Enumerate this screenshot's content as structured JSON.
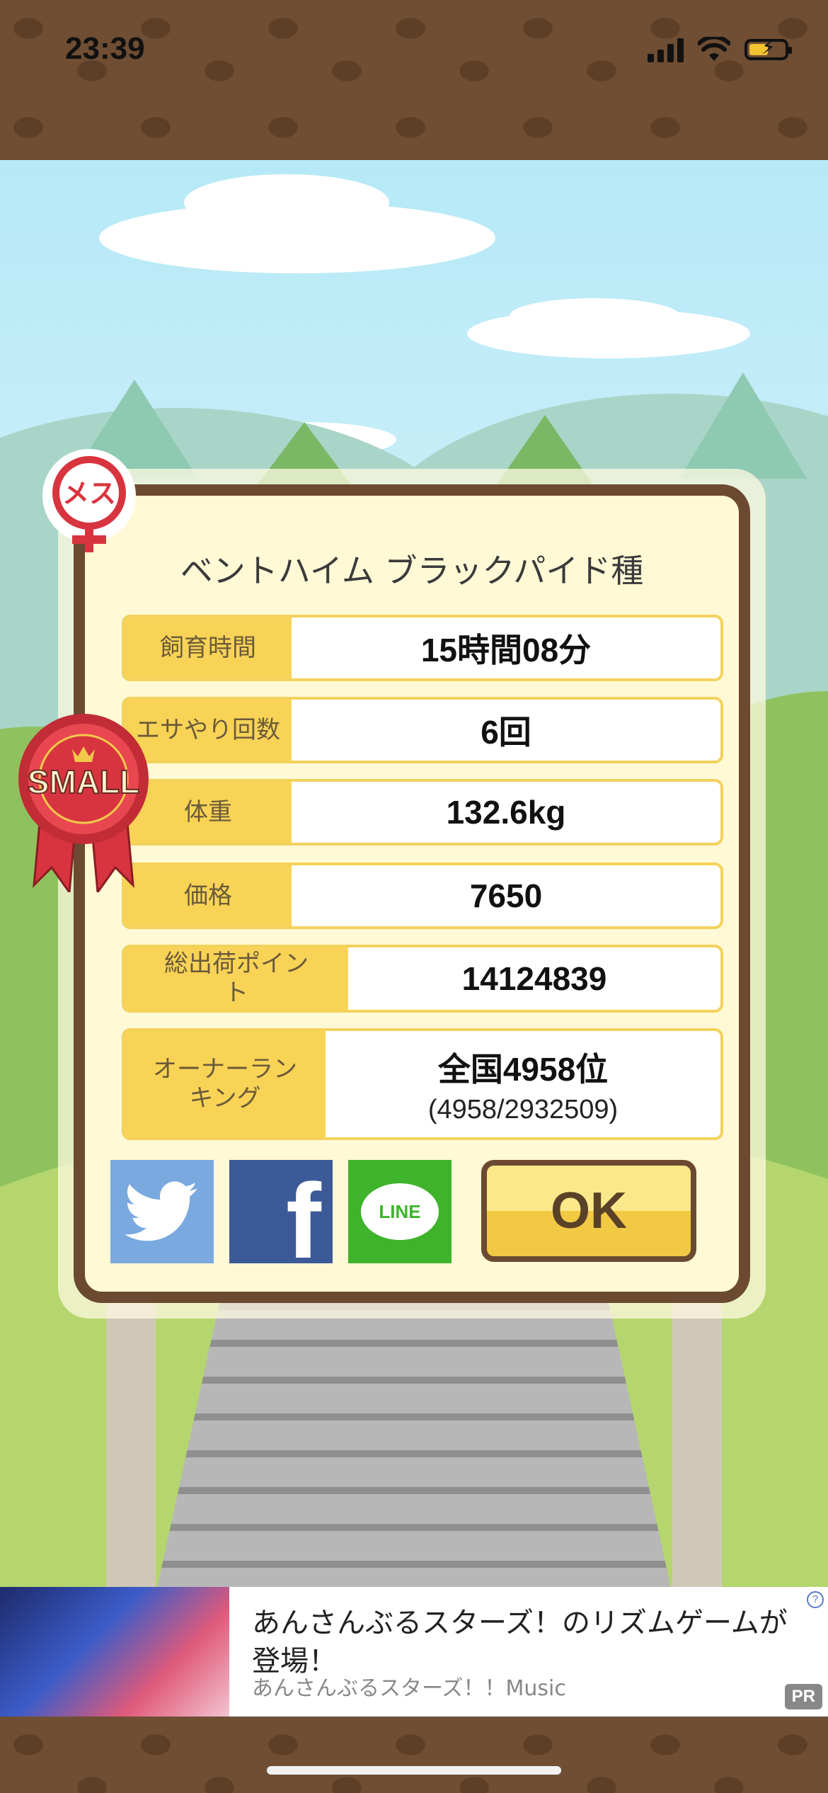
{
  "status": {
    "time": "23:39"
  },
  "dialog": {
    "title": "ベントハイム ブラックパイド種",
    "rows": [
      {
        "label": "飼育時間",
        "value": "15時間08分"
      },
      {
        "label": "エサやり回数",
        "value": "6回"
      },
      {
        "label": "体重",
        "value": "132.6kg"
      },
      {
        "label": "価格",
        "value": "7650"
      },
      {
        "label": "総出荷ポイント",
        "value": "14124839"
      },
      {
        "label": "オーナーランキング",
        "value": "全国4958位",
        "sub": "(4958/2932509)"
      }
    ],
    "ok_label": "OK",
    "share": {
      "twitter_icon": "twitter-bird-icon",
      "facebook_label": "f",
      "line_label": "LINE"
    },
    "colors": {
      "frame": "#6b4a31",
      "label_bg": "#f8d356",
      "panel": "#fff9d6"
    }
  },
  "badges": {
    "female": "メス",
    "size": "SMALL"
  },
  "ad": {
    "title": "あんさんぶるスターズ！のリズムゲームが登場！",
    "sub": "あんさんぶるスターズ！！Music",
    "pr": "PR",
    "info": "?"
  }
}
